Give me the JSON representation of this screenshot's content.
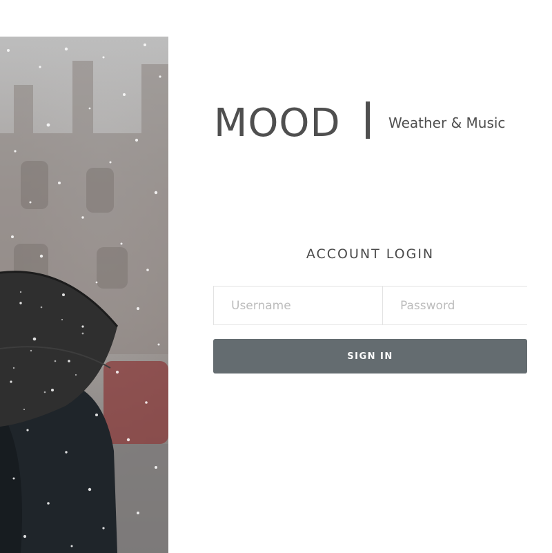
{
  "brand": {
    "name": "MOOD",
    "tagline": "Weather & Music",
    "color": "#4f4f4f"
  },
  "login": {
    "title": "ACCOUNT LOGIN",
    "username_placeholder": "Username",
    "username_value": "",
    "password_placeholder": "Password",
    "password_value": "",
    "signin_label": "SIGN IN",
    "button_color": "#646c70"
  },
  "hero_image": {
    "icons": [
      "umbrella-icon"
    ]
  }
}
